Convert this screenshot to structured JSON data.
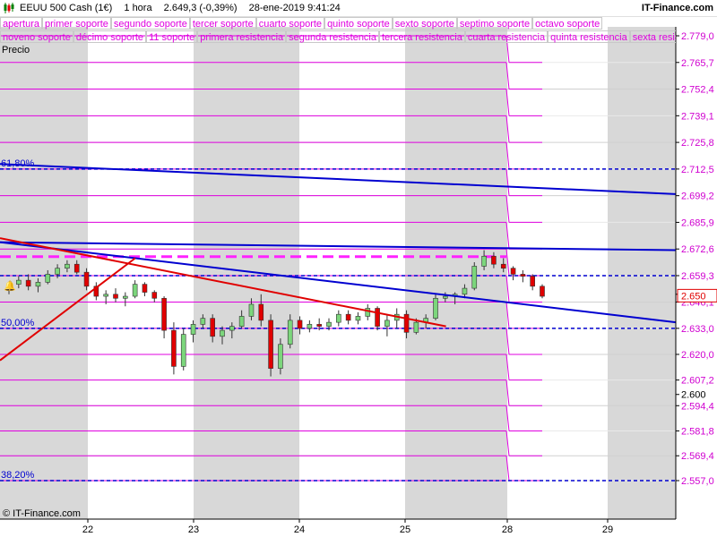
{
  "header": {
    "symbol": "EEUU 500 Cash (1€)",
    "timeframe": "1 hora",
    "price_change": "2.649,3 (-0,39%)",
    "datetime": "28-ene-2019 9:41:24",
    "brand": "IT-Finance.com"
  },
  "legend": {
    "row1": [
      "apertura",
      "primer soporte",
      "segundo soporte",
      "tercer soporte",
      "cuarto soporte",
      "quinto soporte",
      "sexto soporte",
      "septimo soporte",
      "octavo soporte"
    ],
    "row2": [
      "noveno soporte",
      "décimo soporte",
      "11 soporte",
      "primera resistencia",
      "segunda resistencia",
      "tercera resistencia",
      "cuarta resistencia",
      "quinta resistencia",
      "sexta resistencia"
    ],
    "series_label": "Precio",
    "color": "#e000e0"
  },
  "footer": {
    "brand": "© IT-Finance.com"
  },
  "chart_data": {
    "type": "candlestick",
    "x_ticks": [
      "22",
      "23",
      "24",
      "25",
      "28",
      "29"
    ],
    "y_ticks": [
      "2.779,0",
      "2.765,7",
      "2.752,4",
      "2.739,1",
      "2.725,8",
      "2.712,5",
      "2.699,2",
      "2.685,9",
      "2.672,6",
      "2.659,3",
      "2.646,1",
      "2.633,0",
      "2.620,0",
      "2.607,2",
      "2.594,4",
      "2.581,8",
      "2.569,4",
      "2.557,0"
    ],
    "y_ticks_plain": [
      "2.650",
      "2.600"
    ],
    "ylim": [
      2550,
      2785
    ],
    "fib_levels": [
      {
        "label": "61,80%",
        "value": 2712.5
      },
      {
        "label": "50,00%",
        "value": 2633.0
      },
      {
        "label": "38,20%",
        "value": 2557.0
      }
    ],
    "current_price": 2649.3,
    "current_price_label": "2.650",
    "dashed_levels": [
      2659.3
    ],
    "magenta_dashed_level": 2668.8,
    "pivot_levels_prior": [
      2779,
      2765.7,
      2752.4,
      2739.1,
      2725.8,
      2712.5,
      2699.2,
      2685.9,
      2672.6,
      2659.3,
      2646.1,
      2633.0,
      2620.0,
      2607.2,
      2594.4,
      2581.8,
      2569.4,
      2557.0
    ],
    "pivot_levels_current": [
      2765.7,
      2752.4,
      2739.1,
      2725.8,
      2712.5,
      2699.2,
      2685.9,
      2672.6,
      2659.3,
      2646.1,
      2633.0,
      2620.0,
      2607.2,
      2594.4,
      2581.8,
      2569.4,
      2557.0
    ],
    "trendlines": [
      {
        "color": "#0000d0",
        "from": [
          0,
          2715
        ],
        "to": [
          1,
          2700
        ]
      },
      {
        "color": "#0000d0",
        "from": [
          0,
          2676
        ],
        "to": [
          1,
          2672
        ]
      },
      {
        "color": "#0000d0",
        "from": [
          0,
          2676
        ],
        "to": [
          1,
          2636
        ]
      },
      {
        "color": "#e00000",
        "from": [
          0,
          2678
        ],
        "to": [
          0.66,
          2634
        ]
      },
      {
        "color": "#e00000",
        "from": [
          0,
          2617
        ],
        "to": [
          0.2,
          2668
        ]
      }
    ],
    "candles": [
      [
        2654,
        2656,
        2650,
        2655
      ],
      [
        2655,
        2659,
        2653,
        2657
      ],
      [
        2657,
        2660,
        2652,
        2654
      ],
      [
        2654,
        2658,
        2651,
        2656
      ],
      [
        2656,
        2662,
        2655,
        2660
      ],
      [
        2660,
        2665,
        2658,
        2663
      ],
      [
        2663,
        2667,
        2661,
        2665
      ],
      [
        2665,
        2667,
        2660,
        2661
      ],
      [
        2661,
        2663,
        2652,
        2654
      ],
      [
        2654,
        2656,
        2647,
        2649
      ],
      [
        2649,
        2652,
        2645,
        2650
      ],
      [
        2650,
        2653,
        2646,
        2648
      ],
      [
        2648,
        2651,
        2644,
        2649
      ],
      [
        2649,
        2657,
        2648,
        2655
      ],
      [
        2655,
        2656,
        2649,
        2651
      ],
      [
        2651,
        2652,
        2646,
        2648
      ],
      [
        2648,
        2649,
        2628,
        2632
      ],
      [
        2632,
        2636,
        2610,
        2614
      ],
      [
        2614,
        2633,
        2612,
        2630
      ],
      [
        2630,
        2637,
        2626,
        2635
      ],
      [
        2635,
        2640,
        2633,
        2638
      ],
      [
        2638,
        2640,
        2626,
        2629
      ],
      [
        2629,
        2634,
        2625,
        2632
      ],
      [
        2632,
        2636,
        2628,
        2634
      ],
      [
        2634,
        2642,
        2633,
        2639
      ],
      [
        2639,
        2648,
        2637,
        2645
      ],
      [
        2645,
        2650,
        2634,
        2637
      ],
      [
        2637,
        2640,
        2609,
        2613
      ],
      [
        2613,
        2628,
        2610,
        2625
      ],
      [
        2625,
        2640,
        2623,
        2637
      ],
      [
        2637,
        2639,
        2630,
        2633
      ],
      [
        2633,
        2637,
        2631,
        2635
      ],
      [
        2635,
        2638,
        2632,
        2634
      ],
      [
        2634,
        2638,
        2632,
        2636
      ],
      [
        2636,
        2642,
        2634,
        2640
      ],
      [
        2640,
        2642,
        2635,
        2637
      ],
      [
        2637,
        2641,
        2635,
        2639
      ],
      [
        2639,
        2645,
        2637,
        2643
      ],
      [
        2643,
        2644,
        2632,
        2634
      ],
      [
        2634,
        2640,
        2629,
        2637
      ],
      [
        2637,
        2643,
        2633,
        2640
      ],
      [
        2640,
        2642,
        2628,
        2631
      ],
      [
        2631,
        2638,
        2630,
        2636
      ],
      [
        2636,
        2640,
        2633,
        2638
      ],
      [
        2638,
        2650,
        2637,
        2648
      ],
      [
        2648,
        2651,
        2646,
        2649
      ],
      [
        2649,
        2651,
        2645,
        2650
      ],
      [
        2650,
        2655,
        2648,
        2653
      ],
      [
        2653,
        2666,
        2652,
        2664
      ],
      [
        2664,
        2672,
        2662,
        2669
      ],
      [
        2669,
        2671,
        2663,
        2665
      ],
      [
        2665,
        2668,
        2661,
        2663
      ],
      [
        2663,
        2664,
        2657,
        2660
      ],
      [
        2660,
        2662,
        2656,
        2659
      ],
      [
        2659,
        2660,
        2652,
        2654
      ],
      [
        2654,
        2655,
        2648,
        2649
      ]
    ]
  }
}
